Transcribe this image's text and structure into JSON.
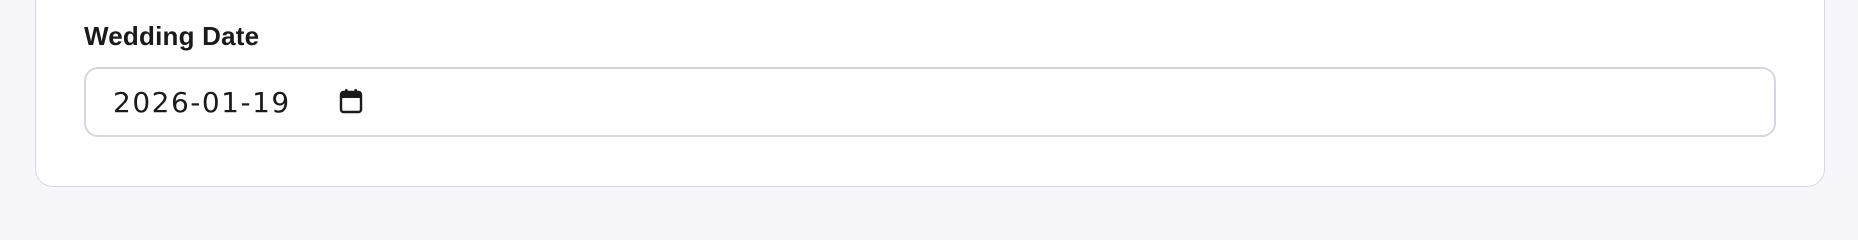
{
  "form": {
    "field_label": "Wedding Date",
    "date_value": "2026-01-19",
    "date_icon": "calendar-icon"
  },
  "colors": {
    "page_background": "#f6f6fb",
    "card_background": "#ffffff",
    "border": "#d6d5e2",
    "text": "#1a1a1a"
  }
}
